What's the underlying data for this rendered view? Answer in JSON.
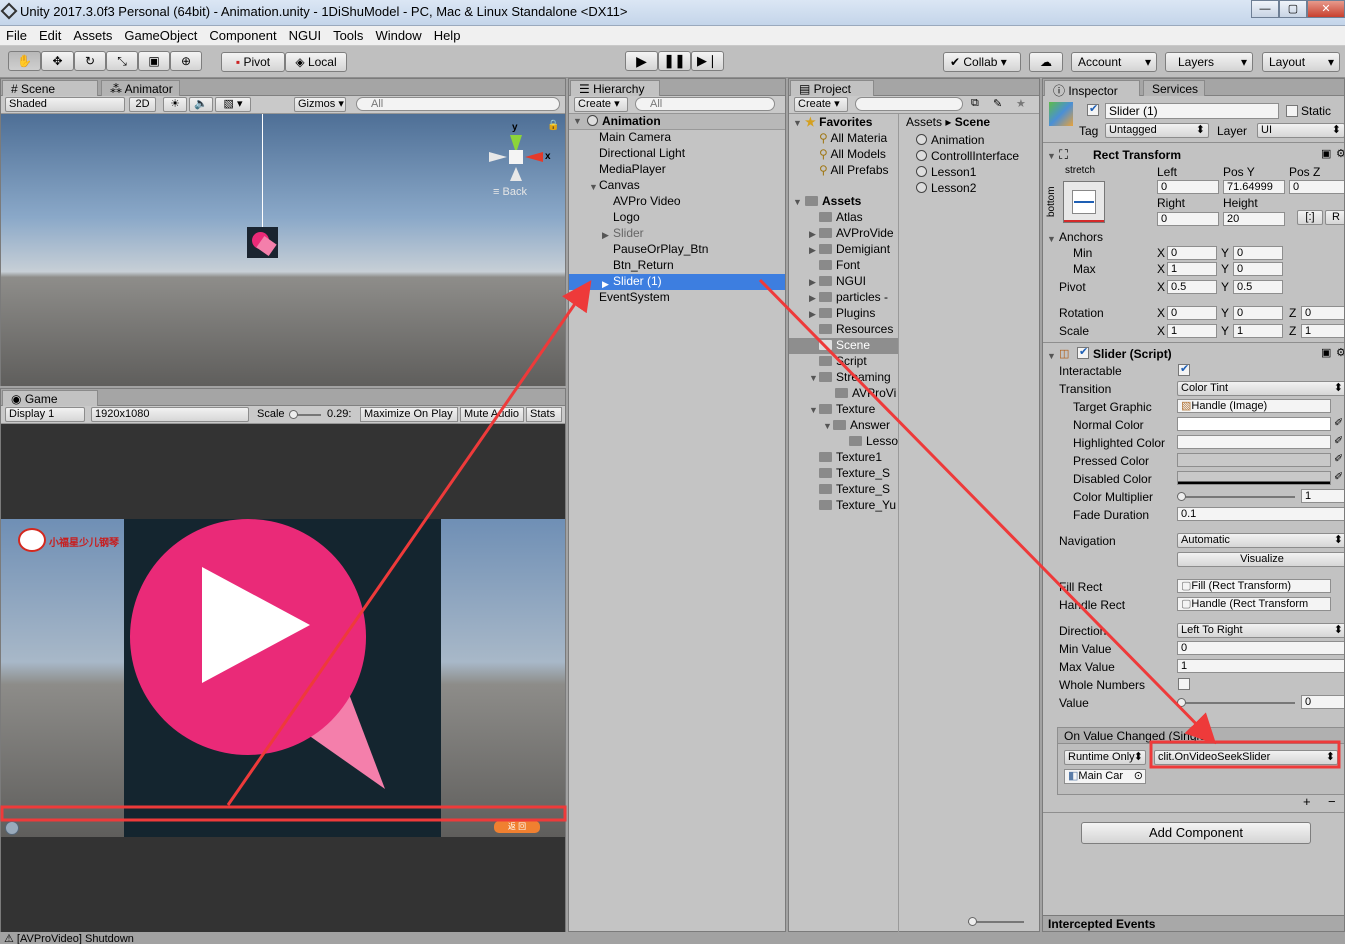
{
  "window": {
    "title": "Unity 2017.3.0f3 Personal (64bit) - Animation.unity - 1DiShuModel - PC, Mac & Linux Standalone <DX11>"
  },
  "menu": [
    "File",
    "Edit",
    "Assets",
    "GameObject",
    "Component",
    "NGUI",
    "Tools",
    "Window",
    "Help"
  ],
  "toolbar": {
    "pivot": "Pivot",
    "local": "Local",
    "collab": "Collab",
    "account": "Account",
    "layers": "Layers",
    "layout": "Layout"
  },
  "scene": {
    "tab": "Scene",
    "animator_tab": "Animator",
    "shading": "Shaded",
    "mode2d": "2D",
    "gizmos": "Gizmos",
    "search_placeholder": "All",
    "back_label": "Back",
    "axis_y": "y",
    "axis_x": "x"
  },
  "game": {
    "tab": "Game",
    "display": "Display 1",
    "resolution": "1920x1080",
    "scale_label": "Scale",
    "scale_value": "0.29:",
    "maximize": "Maximize On Play",
    "mute": "Mute Audio",
    "stats": "Stats",
    "logo_text": "小福星少儿钢琴",
    "return_btn": "返 回"
  },
  "hierarchy": {
    "tab": "Hierarchy",
    "create": "Create",
    "search_placeholder": "All",
    "scene": "Animation",
    "items": [
      "Main Camera",
      "Directional Light",
      "MediaPlayer",
      "Canvas",
      "AVPro Video",
      "Logo",
      "Slider",
      "PauseOrPlay_Btn",
      "Btn_Return",
      "Slider (1)",
      "EventSystem"
    ]
  },
  "project": {
    "tab": "Project",
    "create": "Create",
    "favorites_label": "Favorites",
    "favorites": [
      "All Materia",
      "All Models",
      "All Prefabs"
    ],
    "assets_label": "Assets",
    "folders": [
      "Atlas",
      "AVProVide",
      "Demigiant",
      "Font",
      "NGUI",
      "particles -",
      "Plugins",
      "Resources",
      "Scene",
      "Script",
      "Streaming",
      "AVProVi",
      "Texture",
      "Answer",
      "Lesso",
      "Texture1",
      "Texture_S",
      "Texture_S",
      "Texture_Yu"
    ],
    "breadcrumb_root": "Assets",
    "breadcrumb_current": "Scene",
    "scene_files": [
      "Animation",
      "ControllInterface",
      "Lesson1",
      "Lesson2"
    ]
  },
  "inspector": {
    "tab": "Inspector",
    "services_tab": "Services",
    "object_name": "Slider (1)",
    "static_label": "Static",
    "tag_label": "Tag",
    "tag_value": "Untagged",
    "layer_label": "Layer",
    "layer_value": "UI",
    "rect_transform": {
      "title": "Rect Transform",
      "anchor_preset": "stretch",
      "anchor_side": "bottom",
      "left_label": "Left",
      "posy_label": "Pos Y",
      "posz_label": "Pos Z",
      "left": "0",
      "posy": "71.64999",
      "posz": "0",
      "right_label": "Right",
      "height_label": "Height",
      "right": "0",
      "height": "20",
      "r_btn": "R",
      "anchors_label": "Anchors",
      "min_label": "Min",
      "max_label": "Max",
      "pivot_label": "Pivot",
      "min_x": "0",
      "min_y": "0",
      "max_x": "1",
      "max_y": "0",
      "pivot_x": "0.5",
      "pivot_y": "0.5",
      "rotation_label": "Rotation",
      "scale_label": "Scale",
      "rot_x": "0",
      "rot_y": "0",
      "rot_z": "0",
      "scale_x": "1",
      "scale_y": "1",
      "scale_z": "1",
      "x": "X",
      "y": "Y",
      "z": "Z"
    },
    "slider": {
      "title": "Slider (Script)",
      "interactable": "Interactable",
      "transition": "Transition",
      "transition_value": "Color Tint",
      "target_graphic": "Target Graphic",
      "target_graphic_value": "Handle (Image)",
      "normal_color": "Normal Color",
      "highlighted_color": "Highlighted Color",
      "pressed_color": "Pressed Color",
      "disabled_color": "Disabled Color",
      "color_multiplier": "Color Multiplier",
      "color_multiplier_value": "1",
      "fade_duration": "Fade Duration",
      "fade_duration_value": "0.1",
      "navigation": "Navigation",
      "navigation_value": "Automatic",
      "visualize": "Visualize",
      "fill_rect": "Fill Rect",
      "fill_rect_value": "Fill (Rect Transform)",
      "handle_rect": "Handle Rect",
      "handle_rect_value": "Handle (Rect Transform",
      "direction": "Direction",
      "direction_value": "Left To Right",
      "min_value": "Min Value",
      "min_value_value": "0",
      "max_value": "Max Value",
      "max_value_value": "1",
      "whole_numbers": "Whole Numbers",
      "value": "Value",
      "value_value": "0",
      "event_title": "On Value Changed (Single)",
      "runtime": "Runtime Only",
      "function": "clit.OnVideoSeekSlider",
      "object_ref": "Main Car"
    },
    "add_component": "Add Component",
    "intercepted": "Intercepted Events"
  },
  "status": {
    "text": "[AVProVideo] Shutdown"
  },
  "colors": {
    "accent": "#3d7ee0",
    "annotation": "#ee3a3a",
    "play_button": "#ea2a78",
    "sky": "#8aa8c8",
    "ground": "#6a6a68"
  }
}
